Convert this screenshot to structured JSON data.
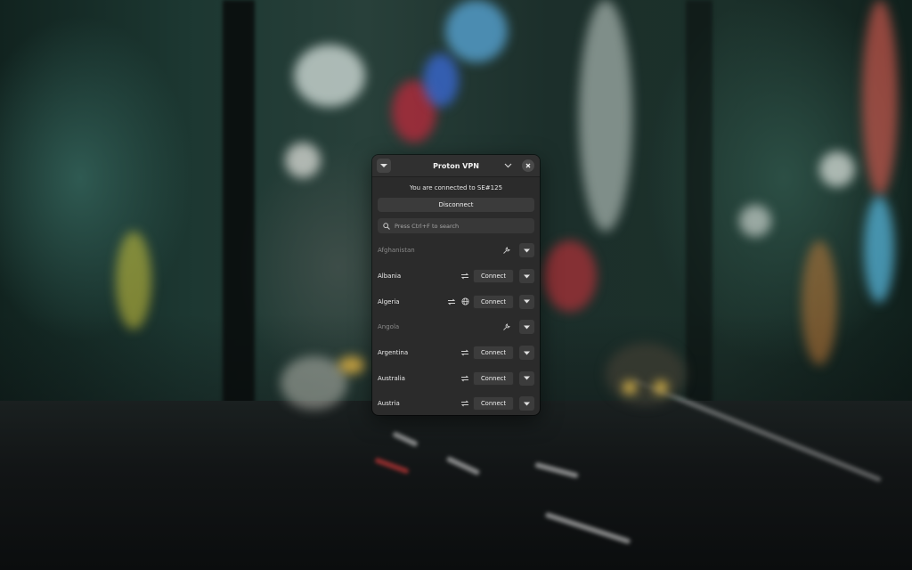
{
  "window": {
    "title": "Proton VPN"
  },
  "status": {
    "text": "You are connected to SE#125"
  },
  "actions": {
    "disconnect_label": "Disconnect"
  },
  "search": {
    "placeholder": "Press Ctrl+F to search",
    "icon": "search-icon"
  },
  "countries": [
    {
      "name": "Afghanistan",
      "available": false,
      "features": [
        "maintenance-icon"
      ],
      "connect_label": ""
    },
    {
      "name": "Albania",
      "available": true,
      "features": [
        "p2p-icon"
      ],
      "connect_label": "Connect"
    },
    {
      "name": "Algeria",
      "available": true,
      "features": [
        "p2p-icon",
        "tor-icon"
      ],
      "connect_label": "Connect"
    },
    {
      "name": "Angola",
      "available": false,
      "features": [
        "maintenance-icon"
      ],
      "connect_label": ""
    },
    {
      "name": "Argentina",
      "available": true,
      "features": [
        "p2p-icon"
      ],
      "connect_label": "Connect"
    },
    {
      "name": "Australia",
      "available": true,
      "features": [
        "p2p-icon"
      ],
      "connect_label": "Connect"
    },
    {
      "name": "Austria",
      "available": true,
      "features": [
        "p2p-icon"
      ],
      "connect_label": "Connect"
    }
  ],
  "colors": {
    "window_bg": "#2b2b2b",
    "button_bg": "#3c3c3c",
    "text": "#ececec",
    "text_dim": "#8a8a8a"
  }
}
